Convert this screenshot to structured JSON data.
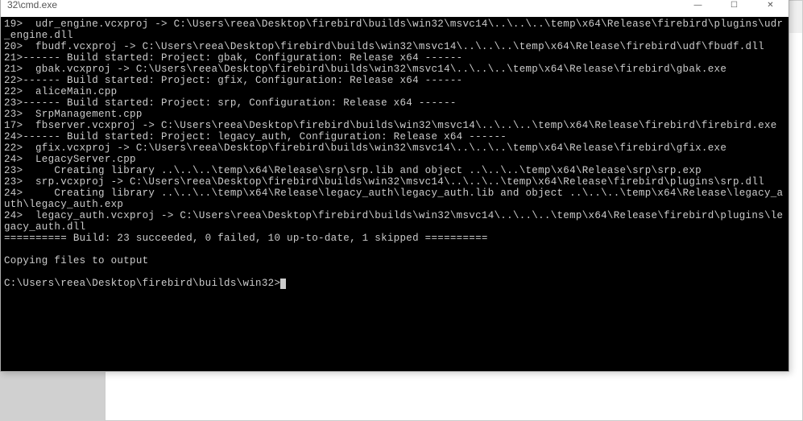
{
  "partial_bg_title": "32\\cmd.exe",
  "window": {
    "title": "32\\cmd.exe",
    "minimize_label": "—",
    "maximize_label": "☐",
    "close_label": "✕"
  },
  "console": {
    "lines": [
      "19>  udr_engine.vcxproj -> C:\\Users\\reea\\Desktop\\firebird\\builds\\win32\\msvc14\\..\\..\\..\\temp\\x64\\Release\\firebird\\plugins\\udr_engine.dll",
      "20>  fbudf.vcxproj -> C:\\Users\\reea\\Desktop\\firebird\\builds\\win32\\msvc14\\..\\..\\..\\temp\\x64\\Release\\firebird\\udf\\fbudf.dll",
      "21>------ Build started: Project: gbak, Configuration: Release x64 ------",
      "21>  gbak.vcxproj -> C:\\Users\\reea\\Desktop\\firebird\\builds\\win32\\msvc14\\..\\..\\..\\temp\\x64\\Release\\firebird\\gbak.exe",
      "22>------ Build started: Project: gfix, Configuration: Release x64 ------",
      "22>  aliceMain.cpp",
      "23>------ Build started: Project: srp, Configuration: Release x64 ------",
      "23>  SrpManagement.cpp",
      "17>  fbserver.vcxproj -> C:\\Users\\reea\\Desktop\\firebird\\builds\\win32\\msvc14\\..\\..\\..\\temp\\x64\\Release\\firebird\\firebird.exe",
      "24>------ Build started: Project: legacy_auth, Configuration: Release x64 ------",
      "22>  gfix.vcxproj -> C:\\Users\\reea\\Desktop\\firebird\\builds\\win32\\msvc14\\..\\..\\..\\temp\\x64\\Release\\firebird\\gfix.exe",
      "24>  LegacyServer.cpp",
      "23>     Creating library ..\\..\\..\\temp\\x64\\Release\\srp\\srp.lib and object ..\\..\\..\\temp\\x64\\Release\\srp\\srp.exp",
      "23>  srp.vcxproj -> C:\\Users\\reea\\Desktop\\firebird\\builds\\win32\\msvc14\\..\\..\\..\\temp\\x64\\Release\\firebird\\plugins\\srp.dll",
      "24>     Creating library ..\\..\\..\\temp\\x64\\Release\\legacy_auth\\legacy_auth.lib and object ..\\..\\..\\temp\\x64\\Release\\legacy_auth\\legacy_auth.exp",
      "24>  legacy_auth.vcxproj -> C:\\Users\\reea\\Desktop\\firebird\\builds\\win32\\msvc14\\..\\..\\..\\temp\\x64\\Release\\firebird\\plugins\\legacy_auth.dll",
      "========== Build: 23 succeeded, 0 failed, 10 up-to-date, 1 skipped ==========",
      "",
      "Copying files to output",
      "",
      "C:\\Users\\reea\\Desktop\\firebird\\builds\\win32>"
    ]
  }
}
